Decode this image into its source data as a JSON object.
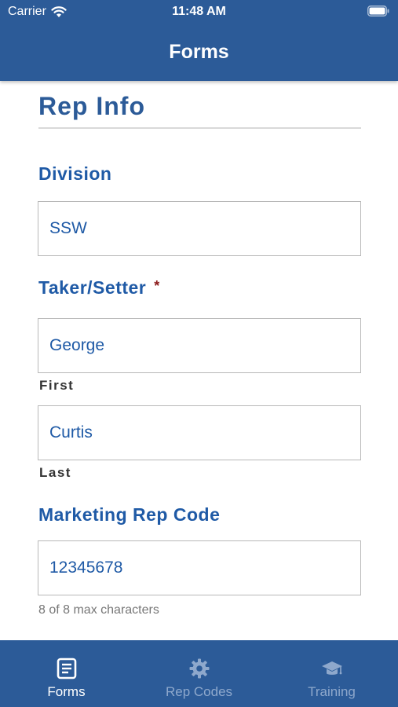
{
  "status_bar": {
    "carrier": "Carrier",
    "time": "11:48 AM"
  },
  "nav": {
    "title": "Forms"
  },
  "form": {
    "section_title": "Rep Info",
    "division": {
      "label": "Division",
      "value": "SSW"
    },
    "taker_setter": {
      "label": "Taker/Setter",
      "required_mark": "*",
      "first_value": "George",
      "first_label": "First",
      "last_value": "Curtis",
      "last_label": "Last"
    },
    "marketing_rep_code": {
      "label": "Marketing Rep Code",
      "value": "12345678",
      "hint": "8 of 8 max characters"
    }
  },
  "tabbar": {
    "tabs": [
      {
        "label": "Forms",
        "icon": "forms-icon",
        "active": true
      },
      {
        "label": "Rep Codes",
        "icon": "gear-icon",
        "active": false
      },
      {
        "label": "Training",
        "icon": "graduation-cap-icon",
        "active": false
      }
    ]
  },
  "colors": {
    "header_bg": "#2c5b98",
    "label_blue": "#1f5aa6",
    "required_red": "#8b1a1a",
    "tab_inactive": "#8ea8cc"
  }
}
